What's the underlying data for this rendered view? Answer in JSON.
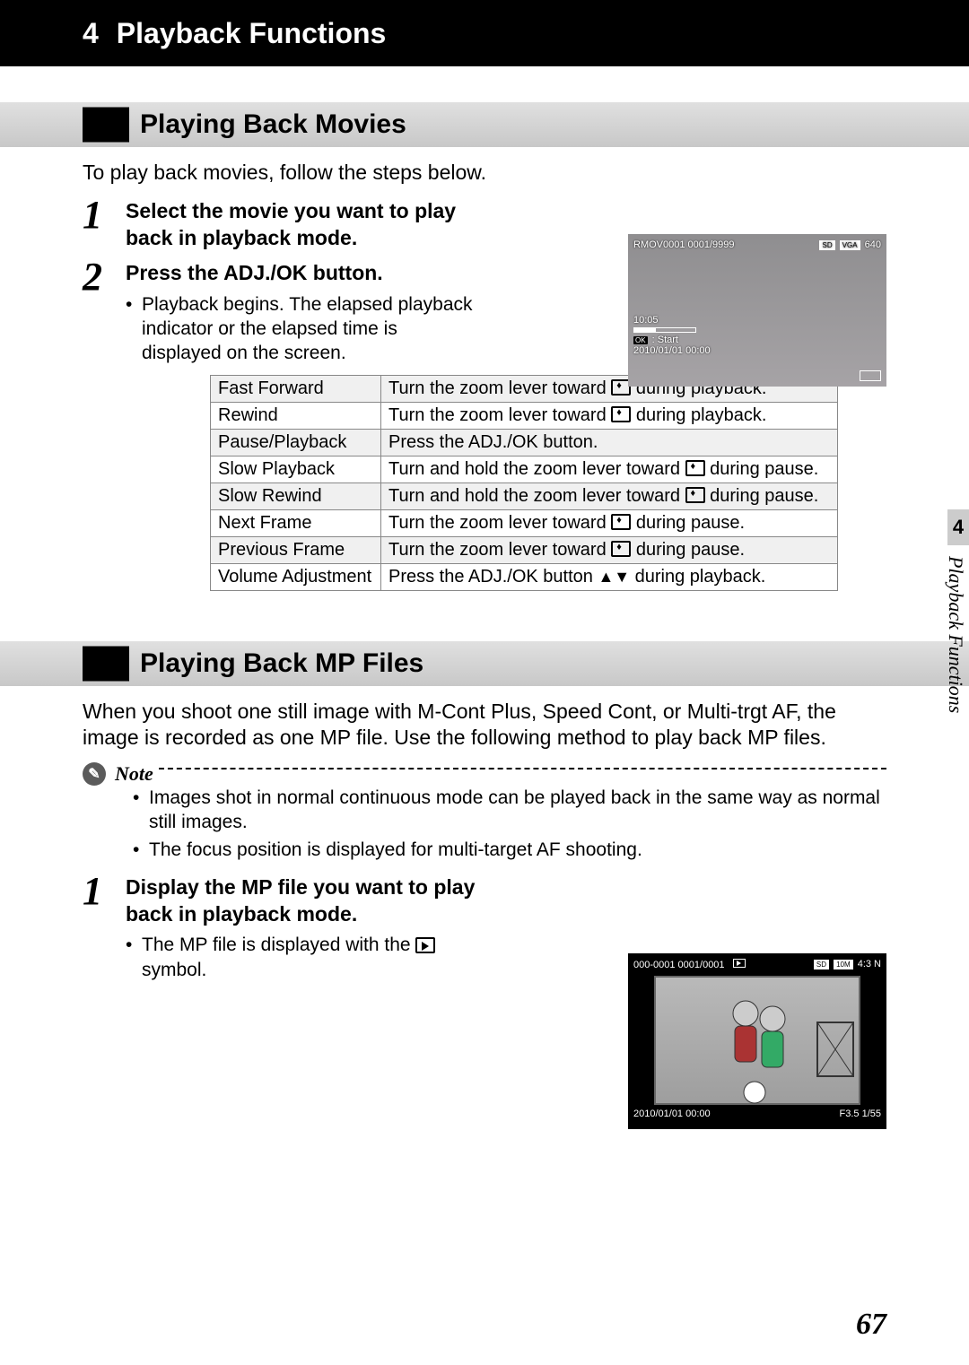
{
  "chapter": {
    "number": "4",
    "title": "Playback Functions"
  },
  "sections": {
    "movies": {
      "title": "Playing Back Movies",
      "intro": "To play back movies, follow the steps below.",
      "steps": [
        {
          "title": "Select the movie you want to play back in playback mode."
        },
        {
          "title": "Press the ADJ./OK button.",
          "bullets": [
            "Playback begins. The elapsed playback indicator or the elapsed time is displayed on the screen."
          ]
        }
      ],
      "figure": {
        "filename": "RMOV0001 0001/9999",
        "badges_right": "SD VGA 640",
        "time": "10:05",
        "start_label": "OK  : Start",
        "datetime": "2010/01/01  00:00"
      },
      "controls": [
        [
          "Fast Forward",
          "Turn the zoom lever toward [▲] during playback."
        ],
        [
          "Rewind",
          "Turn the zoom lever toward [♦] during playback."
        ],
        [
          "Pause/Playback",
          "Press the ADJ./OK button."
        ],
        [
          "Slow Playback",
          "Turn and hold the zoom lever toward [▲] during pause."
        ],
        [
          "Slow Rewind",
          "Turn and hold the zoom lever toward [♦] during pause."
        ],
        [
          "Next Frame",
          "Turn the zoom lever toward [▲] during pause."
        ],
        [
          "Previous Frame",
          "Turn the zoom lever toward [♦] during pause."
        ],
        [
          "Volume Adjustment",
          "Press the ADJ./OK button ▲▼ during playback."
        ]
      ]
    },
    "mp": {
      "title": "Playing Back MP Files",
      "intro": "When you shoot one still image with M-Cont Plus, Speed Cont, or Multi-trgt AF, the image is recorded as one MP file. Use the following method to play back MP files.",
      "note": {
        "label": "Note",
        "bullets": [
          "Images shot in normal continuous mode can be played back in the same way as normal still images.",
          "The focus position is displayed for multi-target AF shooting."
        ]
      },
      "steps": [
        {
          "title": "Display the MP file you want to play back in playback mode.",
          "bullets": [
            "The MP file is displayed with the  symbol."
          ]
        }
      ],
      "figure": {
        "top_left": "000-0001   0001/0001",
        "badges_right": "SD 10M 4:3 N",
        "datetime": "2010/01/01  00:00",
        "exposure": "F3.5  1/55"
      }
    }
  },
  "sidebar": {
    "tab_number": "4",
    "label": "Playback Functions"
  },
  "page_number": "67"
}
